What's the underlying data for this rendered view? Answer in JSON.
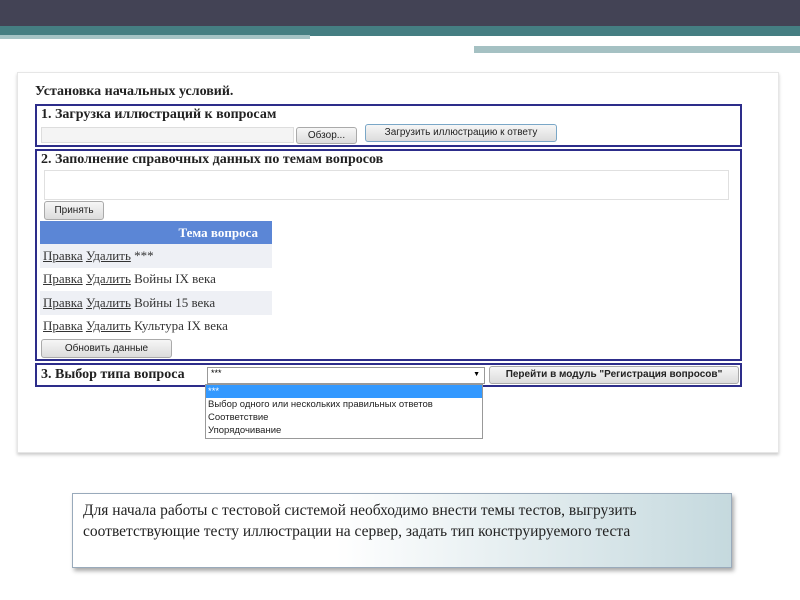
{
  "page_title": "Установка начальных условий.",
  "section1": {
    "heading": "1. Загрузка иллюстраций к вопросам",
    "browse_label": "Обзор...",
    "upload_label": "Загрузить иллюстрацию к ответу"
  },
  "section2": {
    "heading": "2. Заполнение справочных данных по темам вопросов",
    "accept_label": "Принять",
    "table": {
      "header": "Тема вопроса",
      "edit_label": "Правка",
      "delete_label": "Удалить",
      "rows": [
        {
          "topic": "***"
        },
        {
          "topic": "Войны IX века"
        },
        {
          "topic": "Войны 15 века"
        },
        {
          "topic": "Культура IX века"
        }
      ]
    },
    "refresh_label": "Обновить данные"
  },
  "section3": {
    "heading": "3. Выбор типа вопроса",
    "selected": "***",
    "go_label": "Перейти в модуль \"Регистрация вопросов\"",
    "options": [
      "***",
      "Выбор одного или нескольких правильных ответов",
      "Соответствие",
      "Упорядочивание"
    ]
  },
  "note": "Для начала работы  с  тестовой системой необходимо внести  темы тестов, выгрузить соответствующие тесту иллюстрации на сервер, задать тип конструируемого теста"
}
